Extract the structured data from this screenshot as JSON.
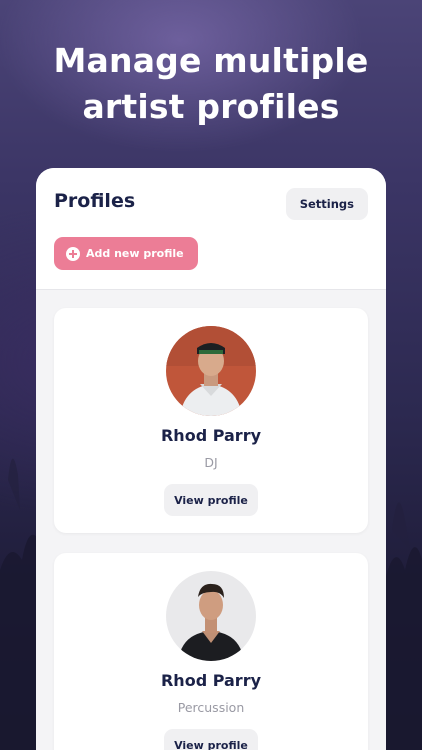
{
  "hero": {
    "line1": "Manage multiple",
    "line2": "artist profiles"
  },
  "panel": {
    "title": "Profiles",
    "settings_label": "Settings",
    "add_label": "Add new profile"
  },
  "profiles": [
    {
      "name": "Rhod Parry",
      "role": "DJ",
      "button_label": "View profile"
    },
    {
      "name": "Rhod Parry",
      "role": "Percussion",
      "button_label": "View profile"
    }
  ],
  "colors": {
    "accent": "#ec7d96",
    "heading": "#1b2248",
    "muted": "#9a9aa4"
  }
}
